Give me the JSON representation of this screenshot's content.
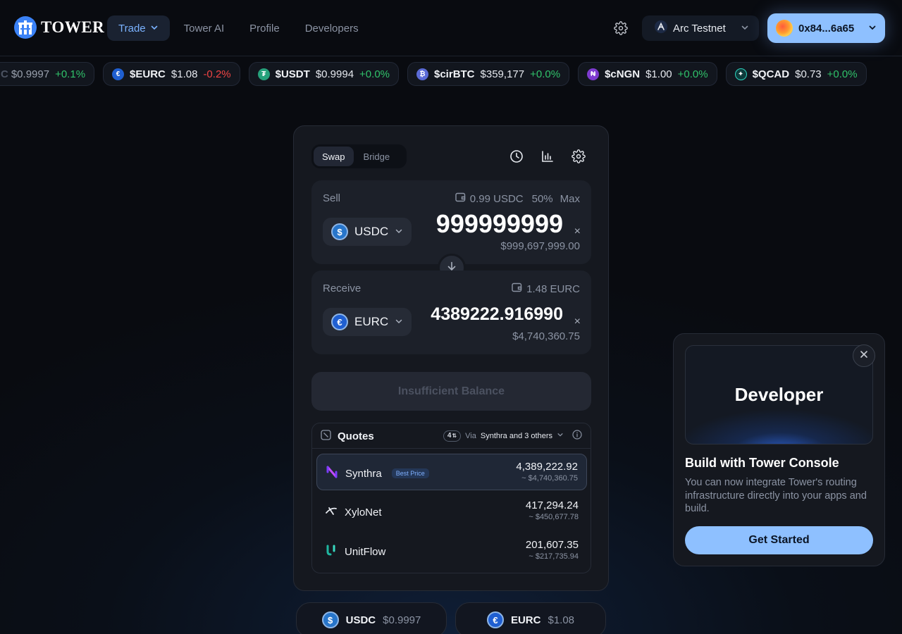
{
  "header": {
    "logo_text": "TOWER",
    "nav": [
      {
        "label": "Trade",
        "active": true
      },
      {
        "label": "Tower AI"
      },
      {
        "label": "Profile"
      },
      {
        "label": "Developers"
      }
    ],
    "network": "Arc Testnet",
    "wallet": "0x84...6a65"
  },
  "ticker": [
    {
      "symbol": "C",
      "price": "$0.9997",
      "change": "+0.1%",
      "dir": "up"
    },
    {
      "symbol": "$EURC",
      "price": "$1.08",
      "change": "-0.2%",
      "dir": "down"
    },
    {
      "symbol": "$USDT",
      "price": "$0.9994",
      "change": "+0.0%",
      "dir": "up"
    },
    {
      "symbol": "$cirBTC",
      "price": "$359,177",
      "change": "+0.0%",
      "dir": "up"
    },
    {
      "symbol": "$cNGN",
      "price": "$1.00",
      "change": "+0.0%",
      "dir": "up"
    },
    {
      "symbol": "$QCAD",
      "price": "$0.73",
      "change": "+0.0%",
      "dir": "up"
    }
  ],
  "swap": {
    "tabs": [
      "Swap",
      "Bridge"
    ],
    "sell": {
      "label": "Sell",
      "balance": "0.99 USDC",
      "half": "50%",
      "max": "Max",
      "token": "USDC",
      "amount": "999999999",
      "usd": "$999,697,999.00"
    },
    "receive": {
      "label": "Receive",
      "balance": "1.48 EURC",
      "token": "EURC",
      "amount": "4389222.916990",
      "usd": "$4,740,360.75"
    },
    "action_label": "Insufficient Balance",
    "clear_glyph": "×"
  },
  "quotes": {
    "title": "Quotes",
    "count": "4",
    "via_prefix": "Via",
    "via_name": "Synthra and 3 others",
    "rows": [
      {
        "name": "Synthra",
        "badge": "Best Price",
        "amount": "4,389,222.92",
        "usd": "~ $4,740,360.75"
      },
      {
        "name": "XyloNet",
        "amount": "417,294.24",
        "usd": "~ $450,677.78"
      },
      {
        "name": "UnitFlow",
        "amount": "201,607.35",
        "usd": "~ $217,735.94"
      }
    ]
  },
  "bottom_pills": [
    {
      "symbol": "USDC",
      "price": "$0.9997"
    },
    {
      "symbol": "EURC",
      "price": "$1.08"
    }
  ],
  "promo": {
    "banner_title": "Developer",
    "title": "Build with Tower Console",
    "description": "You can now integrate Tower's routing infrastructure directly into your apps and build.",
    "cta": "Get Started"
  },
  "colors": {
    "accent": "#8ec0ff",
    "positive": "#30c26a",
    "negative": "#ef4444",
    "usdc": "#2775ca",
    "eurc": "#1f5fd1",
    "usdt": "#26a17b"
  }
}
